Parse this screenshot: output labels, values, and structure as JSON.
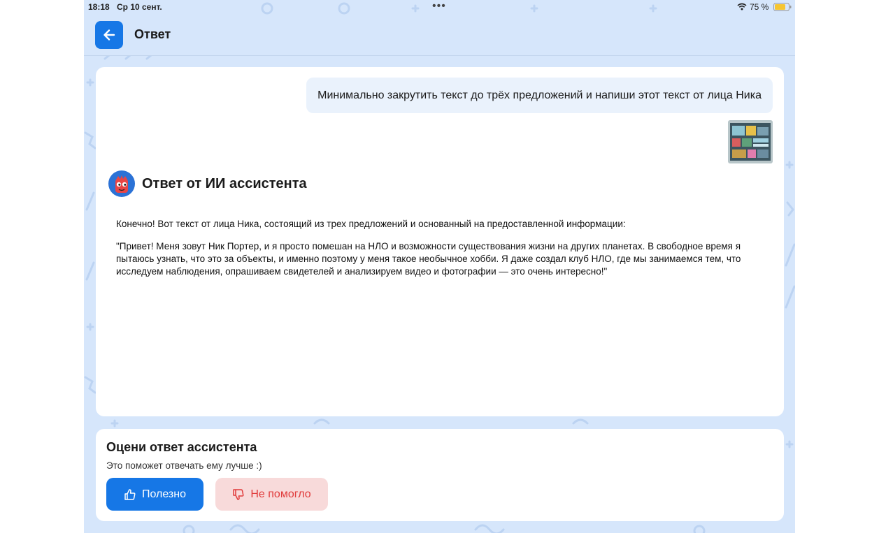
{
  "colors": {
    "accent": "#1677e6",
    "background": "#d6e6fb",
    "user_bubble": "#eaf2fc",
    "negative_bg": "#f8dada",
    "negative_text": "#e03b3b"
  },
  "status_bar": {
    "time": "18:18",
    "date": "Ср 10 сент.",
    "dots": "•••",
    "battery_percent": "75 %",
    "icons": [
      "wifi-icon",
      "battery-icon"
    ]
  },
  "header": {
    "back_icon": "arrow-left-icon",
    "title": "Ответ"
  },
  "chat": {
    "user_message": "Минимально закрутить текст до трёх предложений и напиши этот текст от лица Ника",
    "attachment_icon": "image-thumbnail",
    "ai_title": "Ответ от ИИ ассистента",
    "ai_intro": "Конечно! Вот текст от лица Ника, состоящий из трех предложений и основанный на предоставленной информации:",
    "ai_quote": "\"Привет! Меня зовут Ник Портер, и я просто помешан на НЛО и возможности существования жизни на других планетах. В свободное время я пытаюсь узнать, что это за объекты, и именно поэтому у меня такое необычное хобби. Я даже создал клуб НЛО, где мы занимаемся тем, что исследуем наблюдения, опрашиваем свидетелей и анализируем видео и фотографии — это очень интересно!\""
  },
  "rating": {
    "title": "Оцени ответ ассистента",
    "subtitle": "Это поможет отвечать ему лучше :)",
    "useful_label": "Полезно",
    "useful_icon": "thumbs-up-icon",
    "not_helpful_label": "Не помогло",
    "not_helpful_icon": "thumbs-down-icon"
  }
}
